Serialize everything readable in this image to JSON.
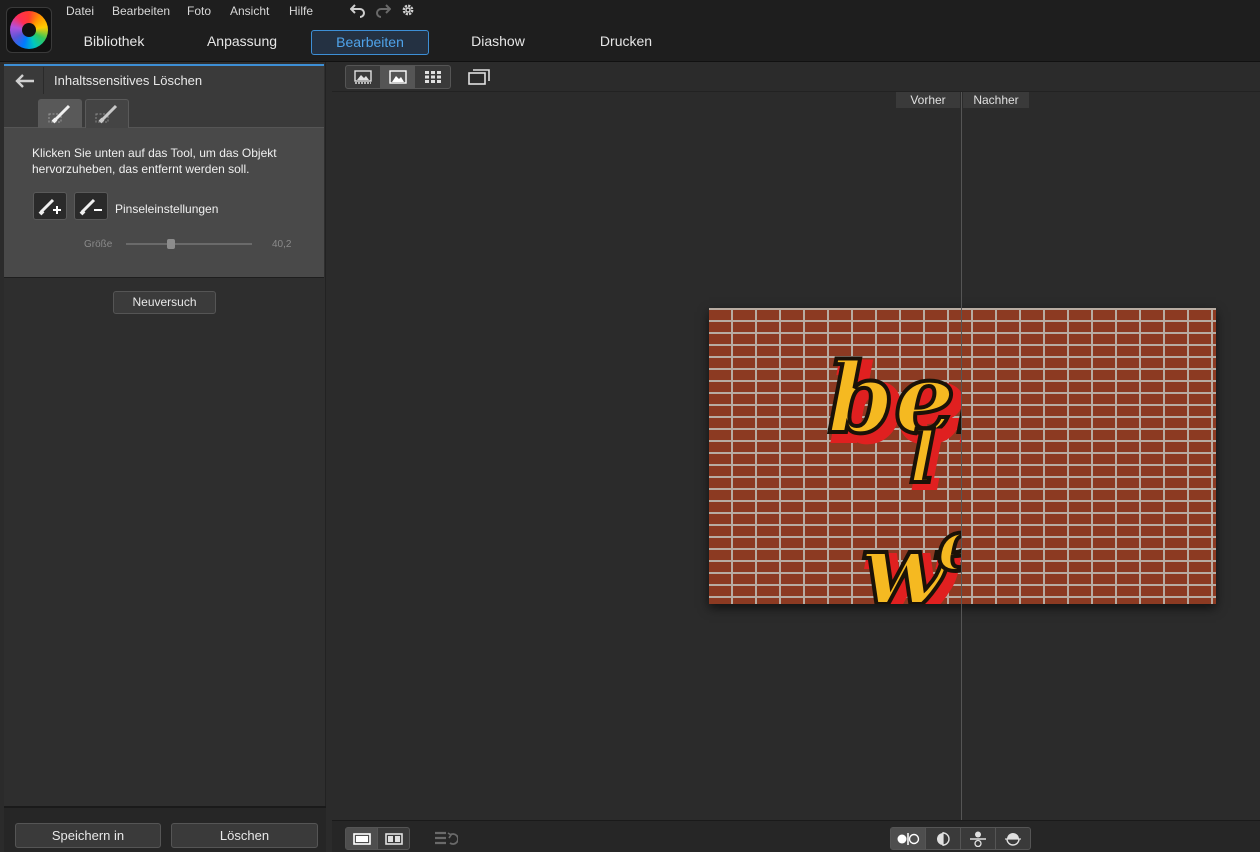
{
  "menu": {
    "items": [
      "Datei",
      "Bearbeiten",
      "Foto",
      "Ansicht",
      "Hilfe"
    ]
  },
  "toolbar_icons": [
    "undo-icon",
    "redo-icon",
    "settings-gear-icon"
  ],
  "modes": {
    "tabs": [
      "Bibliothek",
      "Anpassung",
      "Bearbeiten",
      "Diashow",
      "Drucken"
    ],
    "active": "Bearbeiten"
  },
  "panel": {
    "title": "Inhaltssensitives Löschen",
    "instruction": "Klicken Sie unten auf das Tool, um das Objekt hervorzuheben, das entfernt werden soll.",
    "brush_settings_label": "Pinseleinstellungen",
    "size_label": "Größe",
    "size_value": "40,2",
    "size_fraction": 0.36,
    "retry_label": "Neuversuch",
    "save_in_label": "Speichern in",
    "delete_label": "Löschen"
  },
  "compare": {
    "before_label": "Vorher",
    "after_label": "Nachher"
  },
  "colors": {
    "accent": "#3d8fd6",
    "brick": "#8c3a22",
    "graffiti_yellow": "#f5b921",
    "graffiti_red": "#e02020"
  }
}
